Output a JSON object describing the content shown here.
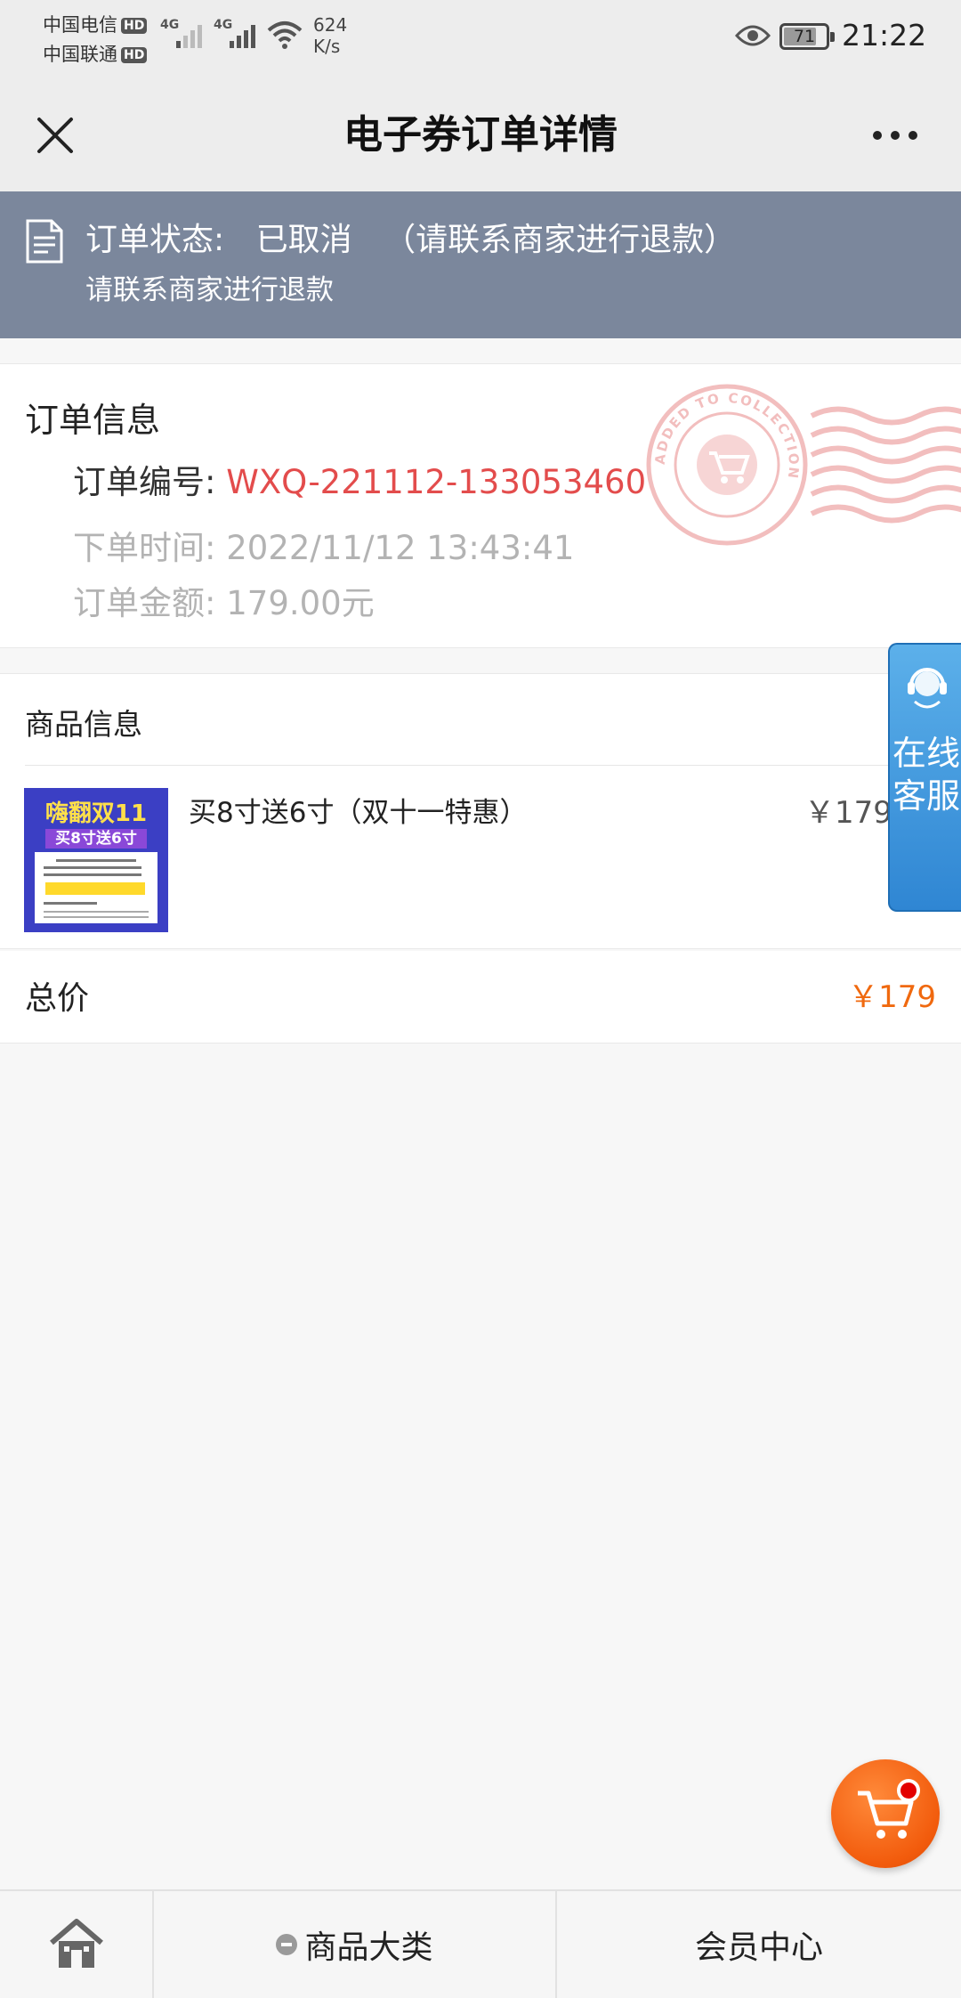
{
  "status_bar": {
    "carrier1": "中国电信",
    "carrier2": "中国联通",
    "hd_label": "HD",
    "network1": "4G",
    "network2": "4G",
    "speed_value": "624",
    "speed_unit": "K/s",
    "battery": "71",
    "time": "21:22"
  },
  "header": {
    "title": "电子券订单详情"
  },
  "order_status": {
    "label": "订单状态:",
    "value": "已取消",
    "note": "（请联系商家进行退款）",
    "subtext": "请联系商家进行退款"
  },
  "order_info": {
    "heading": "订单信息",
    "number_label": "订单编号:",
    "number_value": "WXQ-221112-133053460",
    "time_label": "下单时间:",
    "time_value": "2022/11/12 13:43:41",
    "amount_label": "订单金额:",
    "amount_value": "179.00元",
    "stamp_text": "ADDED TO COLLECTION"
  },
  "product_info": {
    "heading": "商品信息",
    "items": [
      {
        "name": "买8寸送6寸（双十一特惠）",
        "price": "￥179",
        "thumb_title": "嗨翻双11",
        "thumb_subtitle": "买8寸送6寸"
      }
    ]
  },
  "total": {
    "label": "总价",
    "value": "￥179"
  },
  "customer_service": {
    "label": "在线客服"
  },
  "bottom_nav": {
    "category": "商品大类",
    "member": "会员中心"
  },
  "colors": {
    "banner_bg": "#7b879c",
    "order_number": "#e34c4c",
    "total_price": "#f0690f",
    "cs_blue": "#2f86d3",
    "cart_orange": "#f25b0c"
  }
}
